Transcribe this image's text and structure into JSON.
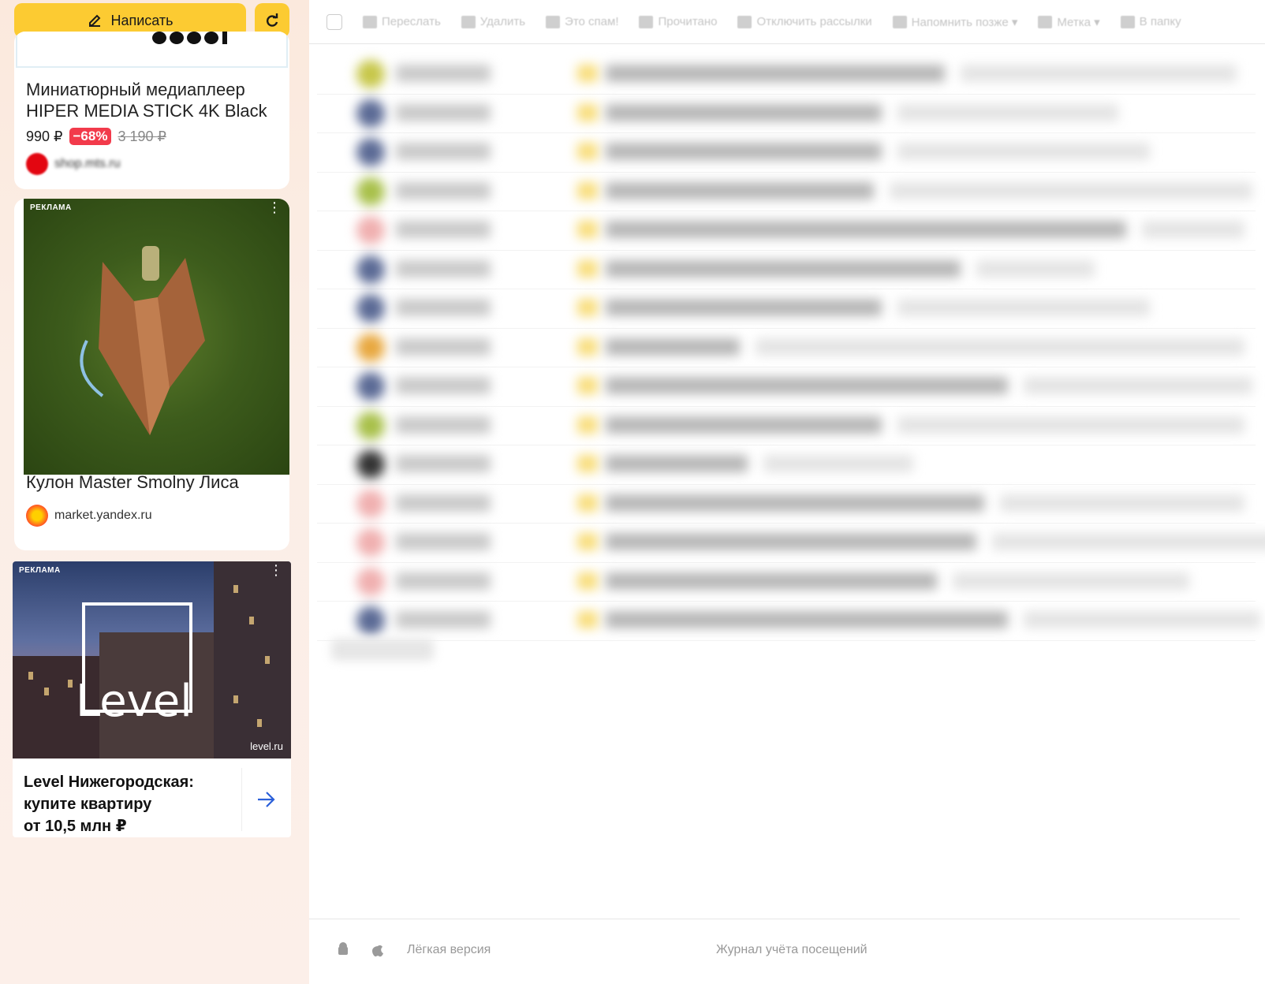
{
  "sidebar": {
    "compose_label": "Написать",
    "ads": [
      {
        "title_line1": "Миниатюрный медиаплеер",
        "title_line2": "HIPER MEDIA STICK 4K Black",
        "price": "990 ₽",
        "discount": "−68%",
        "old_price": "3 190 ₽",
        "source": "shop.mts.ru"
      },
      {
        "label": "РЕКЛАМА",
        "title": "Кулон Master Smolny Лиса",
        "source": "market.yandex.ru"
      },
      {
        "label": "РЕКЛАМА",
        "brand": "Level",
        "site": "level.ru",
        "title_line1": "Level Нижегородская:",
        "title_line2": "купите квартиру",
        "title_line3": "от 10,5 млн ₽"
      }
    ]
  },
  "toolbar": {
    "forward": "Переслать",
    "delete": "Удалить",
    "spam": "Это спам!",
    "read": "Прочитано",
    "unsubscribe": "Отключить рассылки",
    "remind": "Напомнить позже ▾",
    "label": "Метка ▾",
    "folder": "В папку"
  },
  "footer": {
    "light_version": "Лёгкая версия",
    "visits_log": "Журнал учёта посещений"
  },
  "colors": {
    "accent": "#fccb32",
    "discount": "#f23a4b"
  }
}
